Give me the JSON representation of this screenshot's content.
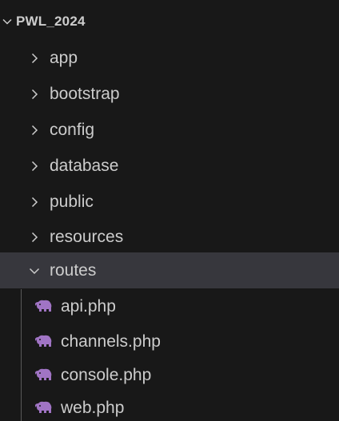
{
  "explorer": {
    "root": {
      "label": "PWL_2024",
      "expanded": true
    },
    "folders": [
      {
        "label": "app",
        "expanded": false
      },
      {
        "label": "bootstrap",
        "expanded": false
      },
      {
        "label": "config",
        "expanded": false
      },
      {
        "label": "database",
        "expanded": false
      },
      {
        "label": "public",
        "expanded": false
      },
      {
        "label": "resources",
        "expanded": false
      },
      {
        "label": "routes",
        "expanded": true,
        "selected": true
      }
    ],
    "routes_files": [
      {
        "label": "api.php",
        "icon": "php-elephant-icon"
      },
      {
        "label": "channels.php",
        "icon": "php-elephant-icon"
      },
      {
        "label": "console.php",
        "icon": "php-elephant-icon"
      },
      {
        "label": "web.php",
        "icon": "php-elephant-icon"
      }
    ]
  },
  "colors": {
    "background": "#181818",
    "selected_row": "#37373d",
    "text": "#cccccc",
    "php_icon": "#a074c4"
  }
}
